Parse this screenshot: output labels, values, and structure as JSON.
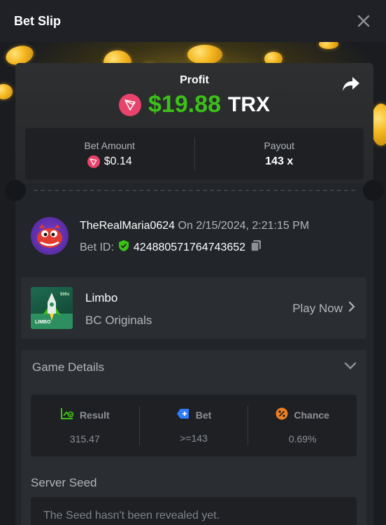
{
  "header": {
    "title": "Bet Slip"
  },
  "profit": {
    "label": "Profit",
    "amount": "$19.88",
    "currency": "TRX"
  },
  "stats": {
    "bet_amount_label": "Bet Amount",
    "bet_amount_value": "$0.14",
    "payout_label": "Payout",
    "payout_value": "143 x"
  },
  "user": {
    "username": "TheRealMaria0624",
    "datetime": "On 2/15/2024, 2:21:15 PM",
    "bet_id_label": "Bet ID:",
    "bet_id_value": "424880571764743652"
  },
  "game": {
    "name": "Limbo",
    "provider": "BC Originals",
    "play_label": "Play Now",
    "thumb_label": "LIMBO",
    "thumb_badge": "500x"
  },
  "details": {
    "title": "Game Details",
    "result_label": "Result",
    "result_value": "315.47",
    "bet_label": "Bet",
    "bet_value": ">=143",
    "chance_label": "Chance",
    "chance_value": "0.69%"
  },
  "seed": {
    "label": "Server Seed",
    "text": "The Seed hasn't been revealed yet."
  },
  "colors": {
    "profit_green": "#3bc117",
    "trx_red": "#e8436b",
    "result_green": "#3bc117",
    "bet_blue": "#2f7dfa",
    "chance_orange": "#ef7f22",
    "verified_green": "#3bc117"
  },
  "icons": {
    "close": "close-icon",
    "share": "share-icon",
    "trx": "trx-icon",
    "verified": "shield-check-icon",
    "copy": "copy-icon",
    "chevron_right": "chevron-right-icon",
    "chevron_down": "chevron-down-icon",
    "result": "chart-check-icon",
    "bet": "tag-icon",
    "chance": "percent-icon"
  }
}
